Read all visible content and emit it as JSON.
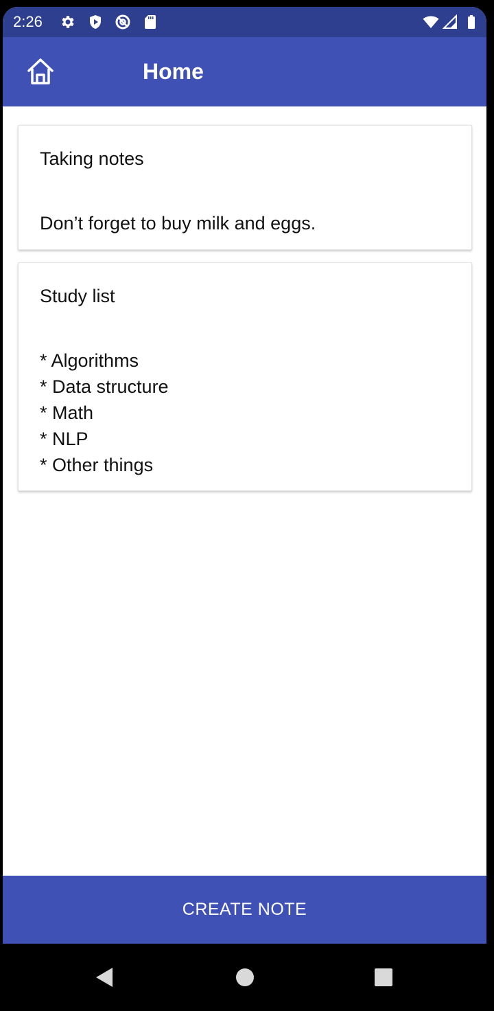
{
  "status_bar": {
    "time": "2:26",
    "left_icons": [
      "gear-icon",
      "shield-play-icon",
      "at-sign-icon",
      "sd-card-icon"
    ],
    "right_icons": [
      "wifi-icon",
      "signal-icon",
      "battery-icon"
    ]
  },
  "app_bar": {
    "title": "Home",
    "icon": "home-icon"
  },
  "notes": [
    {
      "title": "Taking notes",
      "body": "Don’t forget to buy milk and eggs."
    },
    {
      "title": "Study list",
      "body": "* Algorithms\n* Data structure\n* Math\n* NLP\n* Other things"
    }
  ],
  "create_button": {
    "label": "CREATE NOTE"
  },
  "nav_bar": {
    "buttons": [
      "back-icon",
      "home-circle-icon",
      "recents-icon"
    ]
  },
  "colors": {
    "primary": "#3f51b5",
    "status_bar": "#2f3f8f",
    "background": "#ffffff"
  }
}
